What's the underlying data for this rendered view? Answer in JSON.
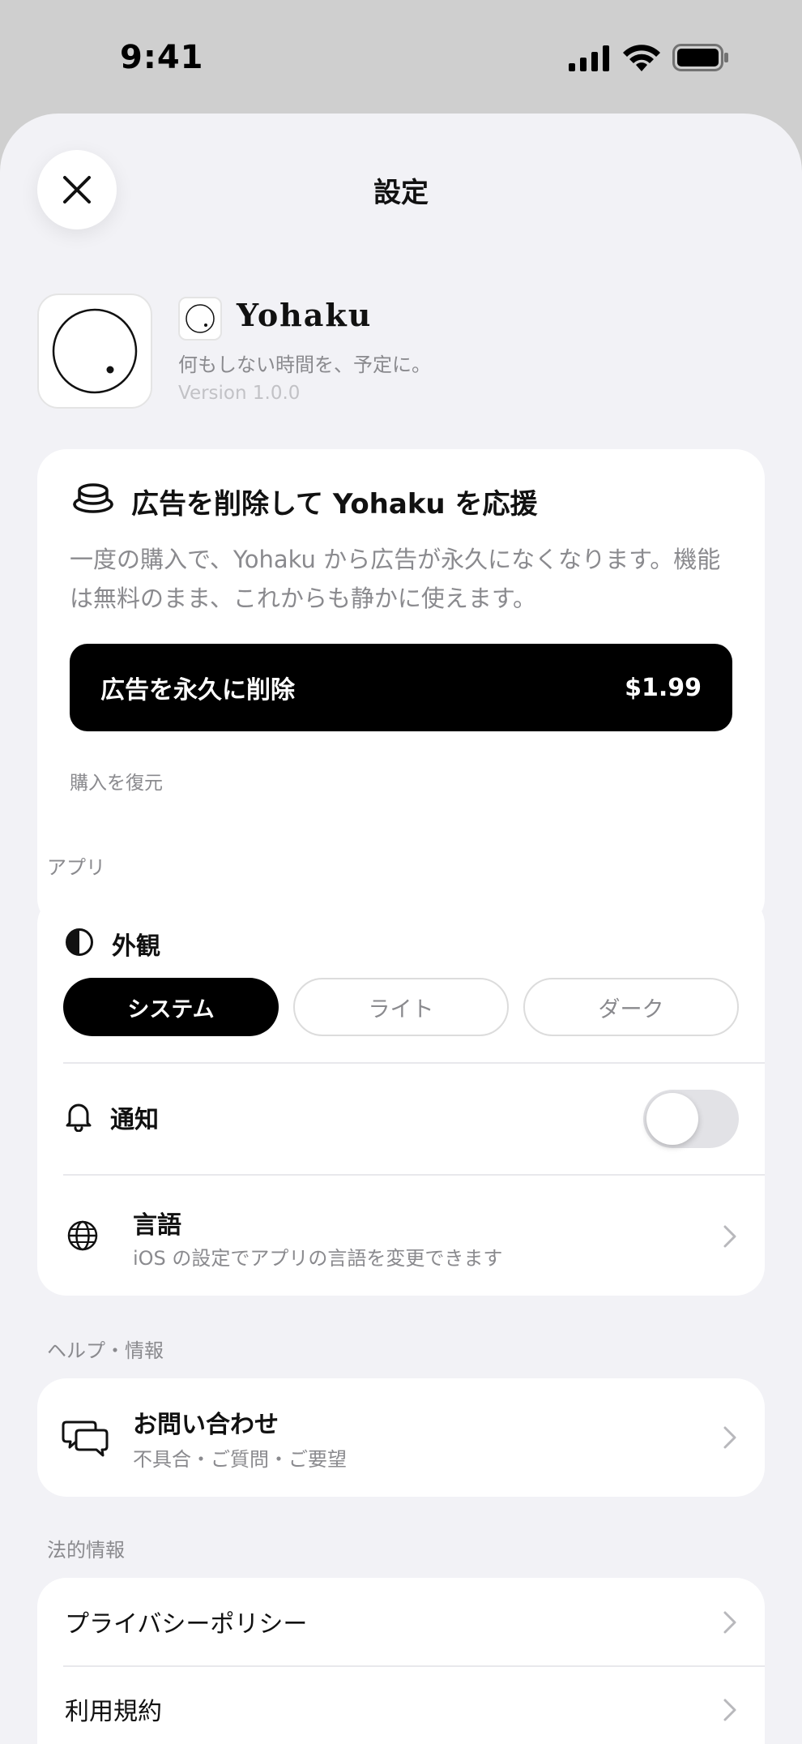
{
  "status_bar": {
    "time": "9:41"
  },
  "header": {
    "title": "設定"
  },
  "app": {
    "name": "Yohaku",
    "tagline": "何もしない時間を、予定に。",
    "version": "Version 1.0.0"
  },
  "promo": {
    "title": "広告を削除して Yohaku を応援",
    "description": "一度の購入で、Yohaku から広告が永久になくなります。機能は無料のまま、これからも静かに使えます。",
    "button_label": "広告を永久に削除",
    "price": "$1.99",
    "restore_label": "購入を復元"
  },
  "sections": {
    "app": "アプリ",
    "help": "ヘルプ・情報",
    "legal": "法的情報"
  },
  "appearance": {
    "label": "外観",
    "options": [
      "システム",
      "ライト",
      "ダーク"
    ],
    "selected": "システム"
  },
  "notifications": {
    "label": "通知",
    "enabled": false
  },
  "language": {
    "label": "言語",
    "subtitle": "iOS の設定でアプリの言語を変更できます"
  },
  "contact": {
    "label": "お問い合わせ",
    "subtitle": "不具合・ご質問・ご要望"
  },
  "legal": {
    "items": [
      "プライバシーポリシー",
      "利用規約"
    ]
  },
  "colors": {
    "accent": "#000000",
    "background": "#f2f2f6",
    "secondary_text": "#8a8a8e"
  },
  "icons": [
    "close-icon",
    "coffee-cup-icon",
    "half-circle-icon",
    "bell-icon",
    "globe-icon",
    "chat-bubbles-icon",
    "chevron-right-icon"
  ]
}
